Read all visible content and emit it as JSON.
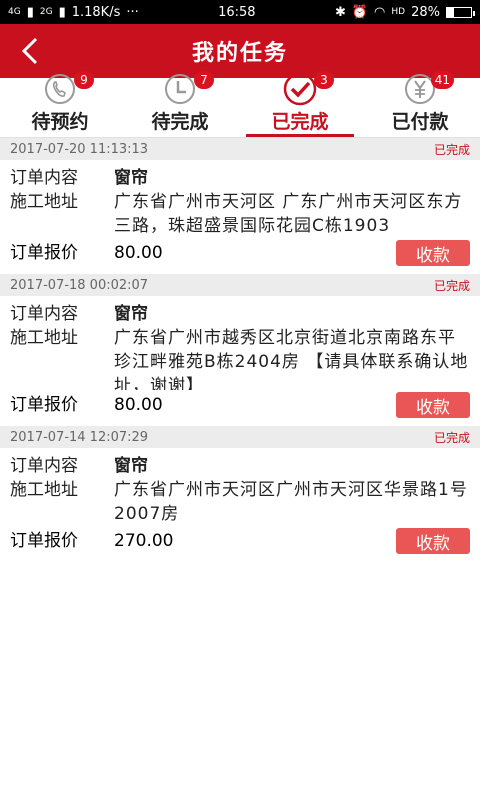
{
  "statusbar": {
    "network_left": "4G",
    "network_right": "2G",
    "speed": "1.18K/s",
    "more": "···",
    "time": "16:58",
    "hd": "HD",
    "battery_percent": "28%",
    "battery_level": 0.28
  },
  "header": {
    "title": "我的任务"
  },
  "tabs": [
    {
      "label": "待预约",
      "badge": "9",
      "icon": "phone-icon"
    },
    {
      "label": "待完成",
      "badge": "7",
      "icon": "clock-icon"
    },
    {
      "label": "已完成",
      "badge": "3",
      "icon": "check-icon",
      "active": true
    },
    {
      "label": "已付款",
      "badge": "41",
      "icon": "yen-icon"
    }
  ],
  "labels": {
    "content": "订单内容",
    "address": "施工地址",
    "price": "订单报价",
    "collect": "收款"
  },
  "orders": [
    {
      "datetime": "2017-07-20 11:13:13",
      "status": "已完成",
      "content": "窗帘",
      "address": "广东省广州市天河区 广东广州市天河区东方三路，珠超盛景国际花园C栋1903",
      "price": "80.00"
    },
    {
      "datetime": "2017-07-18 00:02:07",
      "status": "已完成",
      "content": "窗帘",
      "address": "广东省广州市越秀区北京街道北京南路东平珍江畔雅苑B栋2404房 【请具体联系确认地址，谢谢】",
      "price": "80.00"
    },
    {
      "datetime": "2017-07-14 12:07:29",
      "status": "已完成",
      "content": "窗帘",
      "address": "广东省广州市天河区广州市天河区华景路1号2007房",
      "price": "270.00"
    }
  ]
}
